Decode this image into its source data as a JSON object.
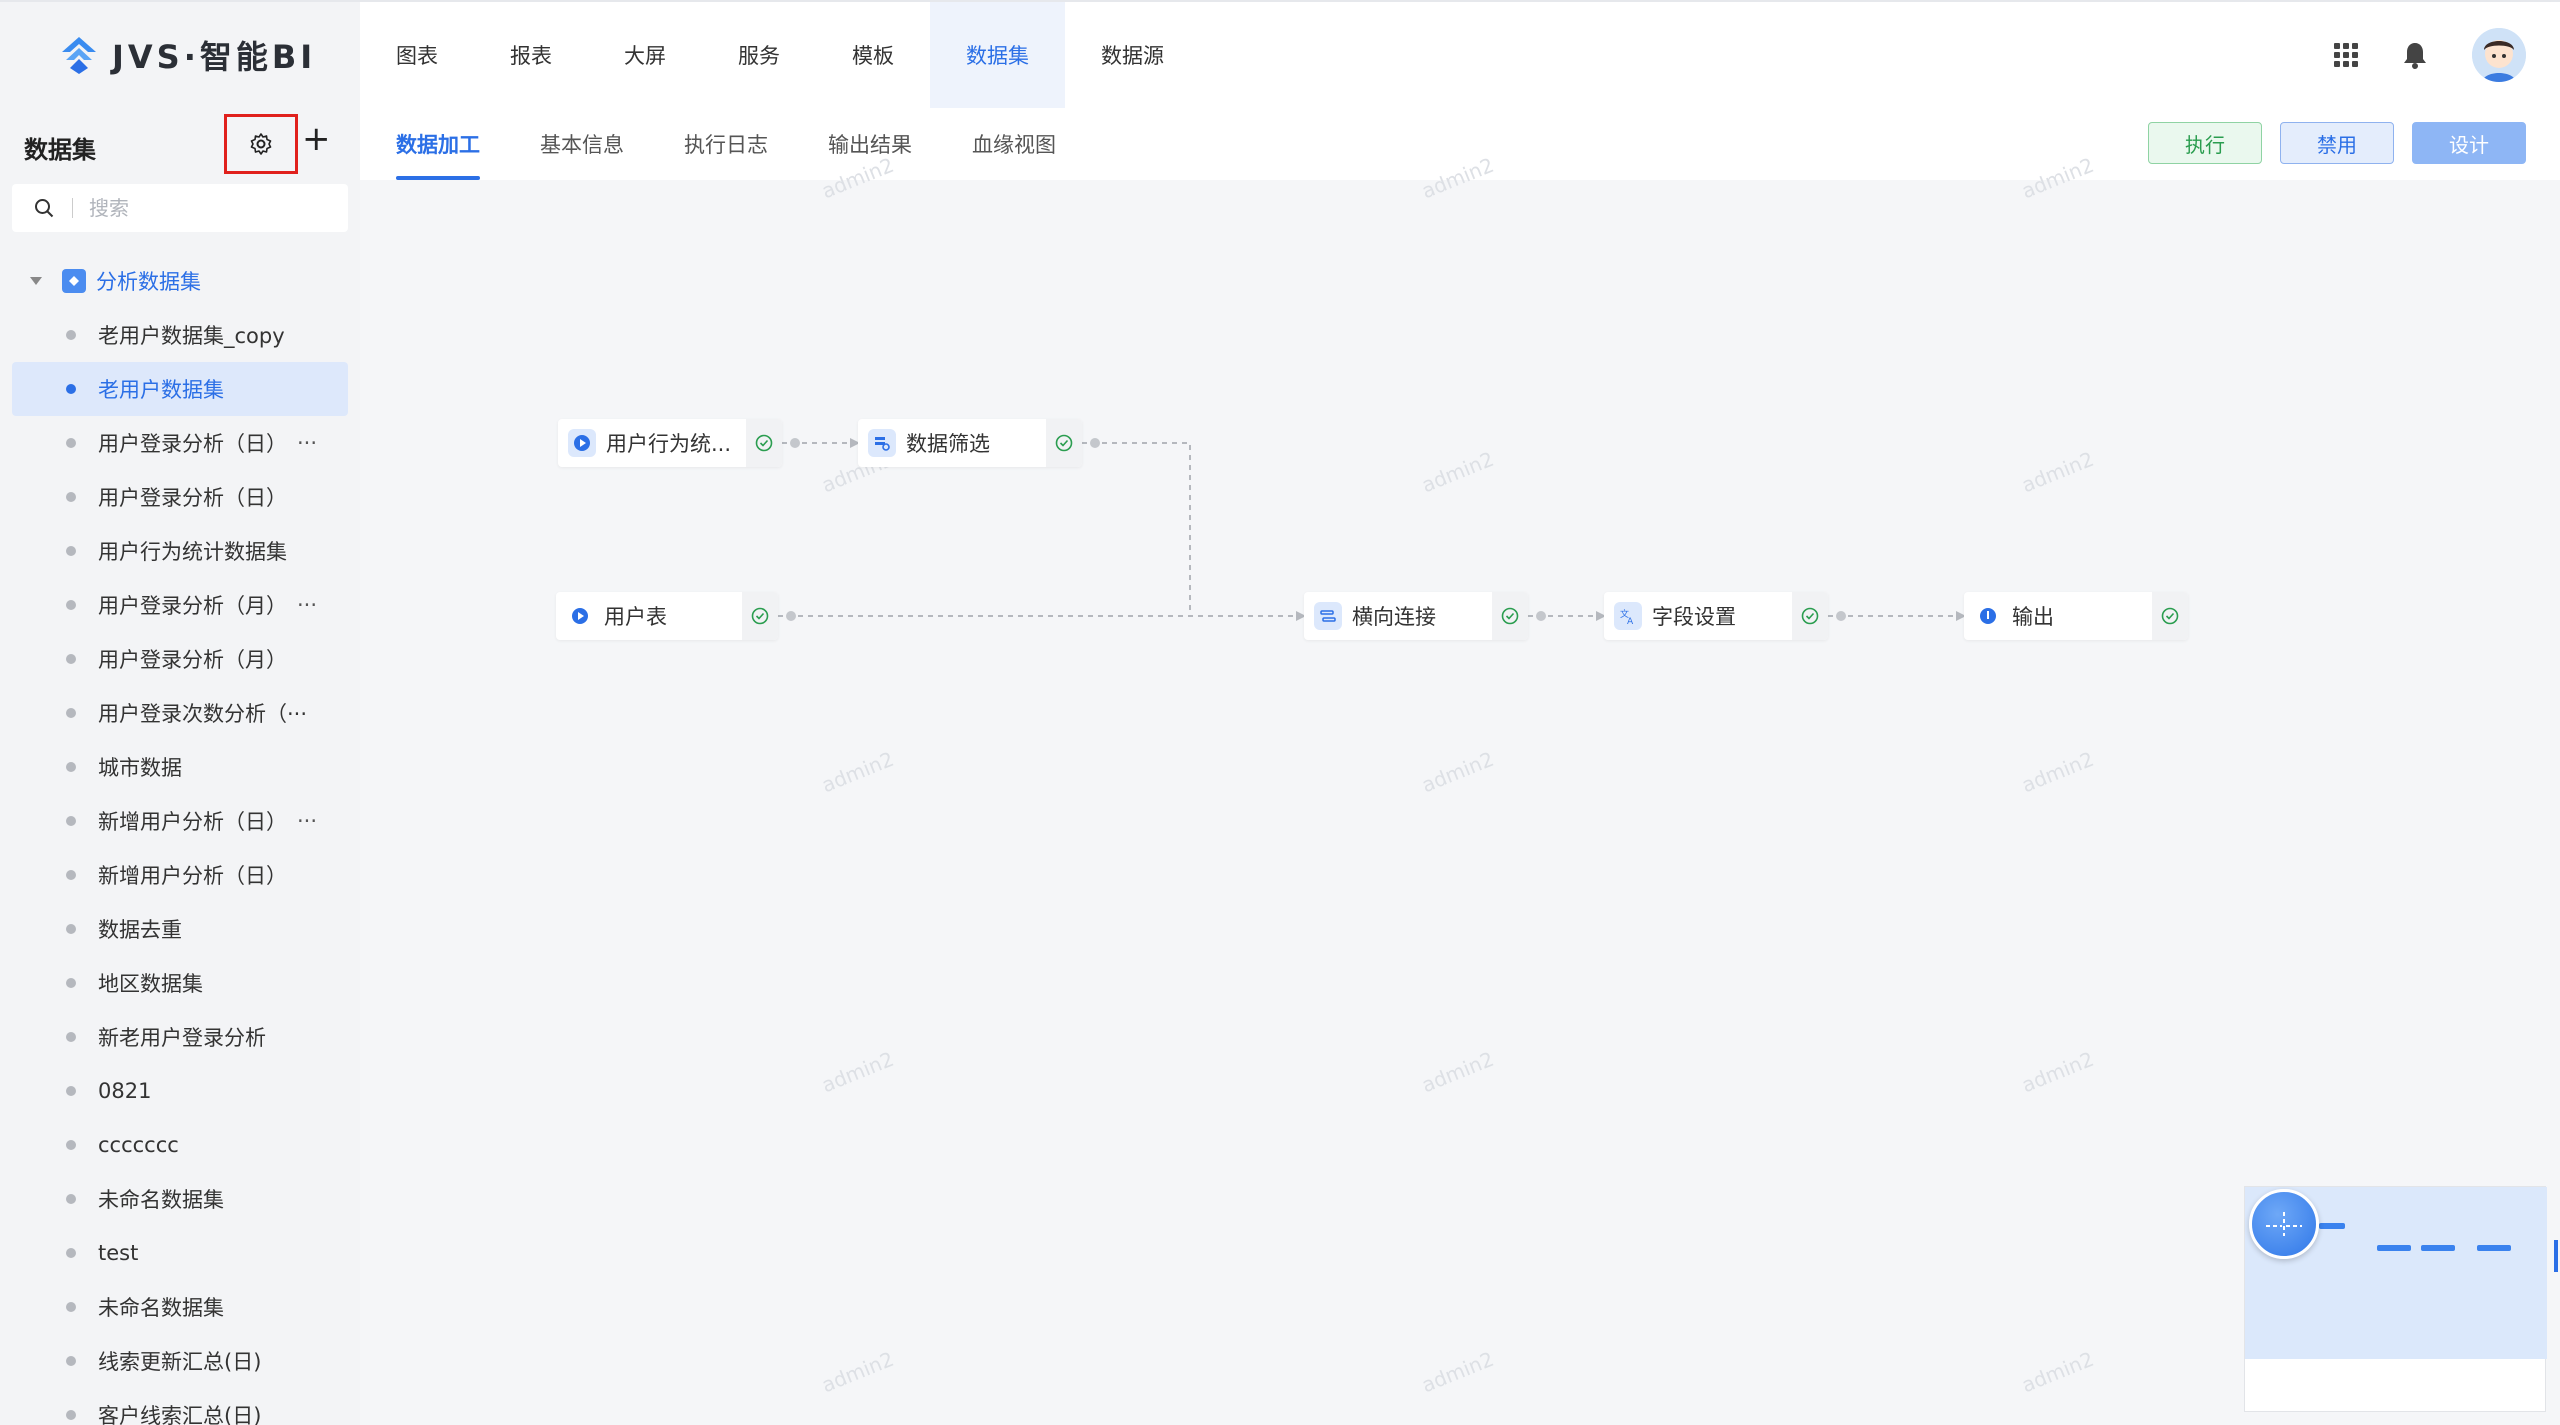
{
  "brand": {
    "name": "JVS·智能BI"
  },
  "topnav": [
    {
      "label": "图表"
    },
    {
      "label": "报表"
    },
    {
      "label": "大屏"
    },
    {
      "label": "服务"
    },
    {
      "label": "模板"
    },
    {
      "label": "数据集",
      "active": true
    },
    {
      "label": "数据源"
    }
  ],
  "sidebar": {
    "title": "数据集",
    "search_placeholder": "搜索",
    "root": {
      "label": "分析数据集"
    },
    "items": [
      {
        "label": "老用户数据集_copy",
        "more": ""
      },
      {
        "label": "老用户数据集",
        "more": "",
        "active": true
      },
      {
        "label": "用户登录分析（日）",
        "more": "···"
      },
      {
        "label": "用户登录分析（日）",
        "more": ""
      },
      {
        "label": "用户行为统计数据集",
        "more": ""
      },
      {
        "label": "用户登录分析（月）",
        "more": "···"
      },
      {
        "label": "用户登录分析（月）",
        "more": ""
      },
      {
        "label": "用户登录次数分析（···",
        "more": ""
      },
      {
        "label": "城市数据",
        "more": ""
      },
      {
        "label": "新增用户分析（日）",
        "more": "···"
      },
      {
        "label": "新增用户分析（日）",
        "more": ""
      },
      {
        "label": "数据去重",
        "more": ""
      },
      {
        "label": "地区数据集",
        "more": ""
      },
      {
        "label": "新老用户登录分析",
        "more": ""
      },
      {
        "label": "0821",
        "more": ""
      },
      {
        "label": "ccccccc",
        "more": ""
      },
      {
        "label": "未命名数据集",
        "more": ""
      },
      {
        "label": "test",
        "more": ""
      },
      {
        "label": "未命名数据集",
        "more": ""
      },
      {
        "label": "线索更新汇总(日)",
        "more": ""
      },
      {
        "label": "客户线索汇总(日)",
        "more": ""
      }
    ]
  },
  "subtabs": [
    {
      "label": "数据加工",
      "active": true
    },
    {
      "label": "基本信息"
    },
    {
      "label": "执行日志"
    },
    {
      "label": "输出结果"
    },
    {
      "label": "血缘视图"
    }
  ],
  "actions": {
    "execute": "执行",
    "disable": "禁用",
    "design": "设计"
  },
  "flow": {
    "nodes": {
      "user_behavior": "用户行为统...",
      "data_filter": "数据筛选",
      "user_table": "用户表",
      "horizontal_join": "横向连接",
      "field_settings": "字段设置",
      "output": "输出"
    }
  },
  "watermark": "admin2",
  "colors": {
    "accent": "#2b6fe6",
    "success": "#2a9d4f",
    "highlight": "#e0201c"
  }
}
